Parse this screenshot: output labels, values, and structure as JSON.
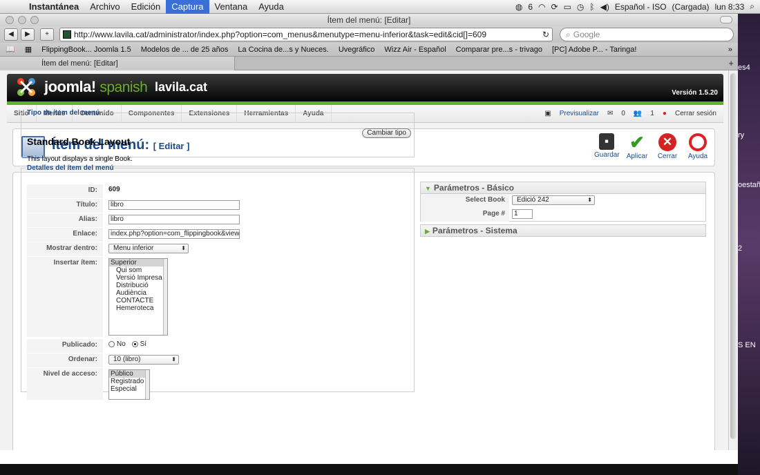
{
  "menubar": {
    "apple": "",
    "items": [
      "Instantánea",
      "Archivo",
      "Edición",
      "Captura",
      "Ventana",
      "Ayuda"
    ],
    "status": {
      "battery": "(Cargada)",
      "time": "lun 8:33",
      "input": "Español - ISO",
      "a_count": "6"
    }
  },
  "window": {
    "title": "Ítem del menú: [Editar]"
  },
  "browser": {
    "back": "◀",
    "forward": "▶",
    "newtab": "+",
    "url": "http://www.lavila.cat/administrator/index.php?option=com_menus&menutype=menu-inferior&task=edit&cid[]=609",
    "reload": "↻",
    "search_placeholder": "Google",
    "bookmarks": [
      "FlippingBook... Joomla 1.5",
      "Modelos de ... de 25 años",
      "La Cocina de...s y Nueces.",
      "Uvegráfico",
      "Wizz Air - Español",
      "Comparar pre...s - trivago",
      "[PC] Adobe P... - Taringa!"
    ],
    "tab_title": "Ítem del menú: [Editar]"
  },
  "joomla": {
    "brand": "joomla!",
    "brand_sub": "spanish",
    "site": "lavila.cat",
    "version": "Versión 1.5.20",
    "menu": [
      "Sitio",
      "Menús",
      "Contenido",
      "Componentes",
      "Extensiones",
      "Herramientas",
      "Ayuda"
    ],
    "status": {
      "preview": "Previsualizar",
      "messages": "0",
      "users": "1",
      "logout": "Cerrar sesión"
    },
    "page_title": "Ítem del menú:",
    "page_sub": "[ Editar ]",
    "buttons": {
      "save": "Guardar",
      "apply": "Aplicar",
      "close": "Cerrar",
      "help": "Ayuda"
    }
  },
  "type_panel": {
    "legend": "Tipo de ítem del menú",
    "heading": "Standard Book Layout",
    "description": "This layout displays a single Book.",
    "change_button": "Cambiar tipo"
  },
  "details": {
    "legend": "Detalles del ítem del menú",
    "id_label": "ID:",
    "id_value": "609",
    "title_label": "Título:",
    "title_value": "libro",
    "alias_label": "Alias:",
    "alias_value": "libro",
    "link_label": "Enlace:",
    "link_value": "index.php?option=com_flippingbook&view=",
    "show_in_label": "Mostrar dentro:",
    "show_in_value": "Menu inferior",
    "insert_label": "Insertar ítem:",
    "insert_options": [
      "Superior",
      "Qui som",
      "Versió Impresa",
      "Distribució",
      "Audiència",
      "CONTACTE",
      "Hemeroteca"
    ],
    "published_label": "Publicado:",
    "published_no": "No",
    "published_yes": "Sí",
    "order_label": "Ordenar:",
    "order_value": "10 (libro)",
    "access_label": "Nivel de acceso:",
    "access_options": [
      "Público",
      "Registrado",
      "Especial"
    ]
  },
  "params_basic": {
    "title": "Parámetros - Básico",
    "book_label": "Select Book",
    "book_value": "Edició 242",
    "page_label": "Page #",
    "page_value": "1"
  },
  "params_system": {
    "title": "Parámetros - Sistema"
  },
  "desktop": {
    "labels": [
      "es4",
      "ry",
      "oestañ",
      "2",
      "S EN"
    ]
  }
}
